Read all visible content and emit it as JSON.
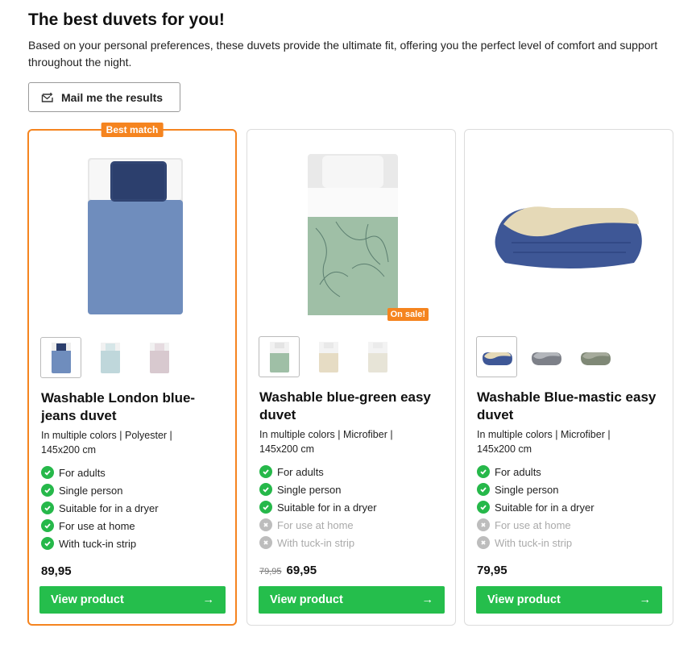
{
  "page": {
    "title": "The best duvets for you!",
    "subtitle": "Based on your personal preferences, these duvets provide the ultimate fit, offering you the perfect level of comfort and support throughout the night.",
    "mail_button": "Mail me the results"
  },
  "colors": {
    "accent_orange": "#f5841f",
    "cta_green": "#25be4c",
    "check_green": "#26b84a",
    "disabled_grey": "#bdbdbd"
  },
  "products": [
    {
      "badge": "Best match",
      "name": "Washable London blue-jeans duvet",
      "specs": "In multiple colors | Polyester | 145x200 cm",
      "features": [
        {
          "label": "For adults",
          "available": true
        },
        {
          "label": "Single person",
          "available": true
        },
        {
          "label": "Suitable for in a dryer",
          "available": true
        },
        {
          "label": "For use at home",
          "available": true
        },
        {
          "label": "With tuck-in strip",
          "available": true
        }
      ],
      "old_price": "",
      "price": "89,95",
      "button": "View product",
      "button_icon": "arrow-right-icon"
    },
    {
      "sale_badge": "On sale!",
      "name": "Washable blue-green easy duvet",
      "specs": "In multiple colors | Microfiber | 145x200 cm",
      "features": [
        {
          "label": "For adults",
          "available": true
        },
        {
          "label": "Single person",
          "available": true
        },
        {
          "label": "Suitable for in a dryer",
          "available": true
        },
        {
          "label": "For use at home",
          "available": false
        },
        {
          "label": "With tuck-in strip",
          "available": false
        }
      ],
      "old_price": "79,95",
      "price": "69,95",
      "button": "View product",
      "button_icon": "arrow-right-icon"
    },
    {
      "name": "Washable Blue-mastic easy duvet",
      "specs": "In multiple colors | Microfiber | 145x200 cm",
      "features": [
        {
          "label": "For adults",
          "available": true
        },
        {
          "label": "Single person",
          "available": true
        },
        {
          "label": "Suitable for in a dryer",
          "available": true
        },
        {
          "label": "For use at home",
          "available": false
        },
        {
          "label": "With tuck-in strip",
          "available": false
        }
      ],
      "old_price": "",
      "price": "79,95",
      "button": "View product",
      "button_icon": "arrow-right-icon"
    }
  ]
}
